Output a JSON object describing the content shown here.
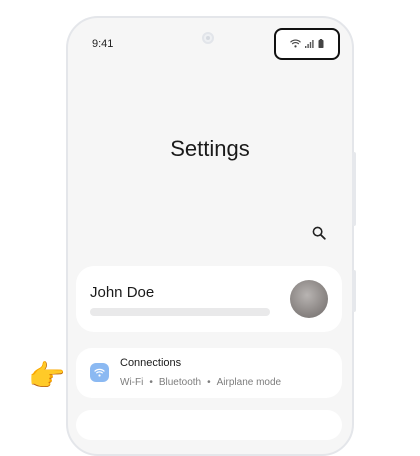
{
  "status_bar": {
    "time": "9:41",
    "icons": [
      "wifi-icon",
      "signal-icon",
      "battery-icon"
    ]
  },
  "page": {
    "title": "Settings"
  },
  "header": {
    "search_icon": "search-icon"
  },
  "profile": {
    "name": "John Doe"
  },
  "connections": {
    "title": "Connections",
    "subtitles": [
      "Wi-Fi",
      "Bluetooth",
      "Airplane mode"
    ],
    "separator": "•",
    "icon": "wifi-icon",
    "icon_color": "#8bb9f2"
  },
  "pointer": {
    "emoji": "👉"
  }
}
